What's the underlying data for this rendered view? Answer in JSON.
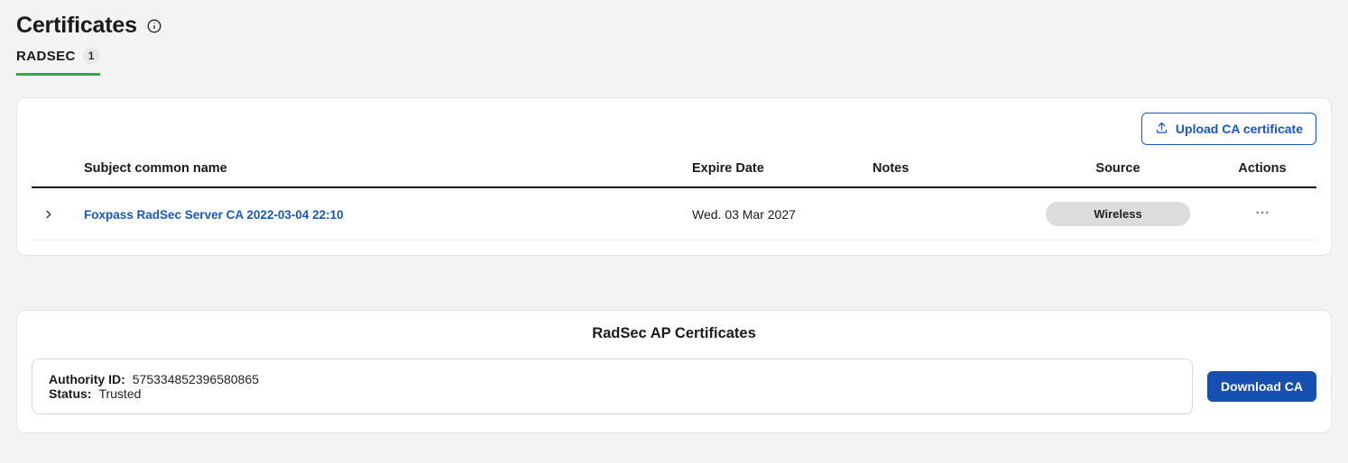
{
  "header": {
    "title": "Certificates"
  },
  "tabs": {
    "radsec": {
      "label": "RADSEC",
      "count": "1"
    }
  },
  "toolbar": {
    "upload_label": "Upload CA certificate"
  },
  "table": {
    "headers": {
      "subject": "Subject common name",
      "expire": "Expire Date",
      "notes": "Notes",
      "source": "Source",
      "actions": "Actions"
    },
    "rows": [
      {
        "subject": "Foxpass RadSec Server CA 2022-03-04 22:10",
        "expire": "Wed. 03 Mar 2027",
        "notes": "",
        "source": "Wireless"
      }
    ]
  },
  "ap_card": {
    "title": "RadSec AP Certificates",
    "authority_id_label": "Authority ID:",
    "authority_id_value": "575334852396580865",
    "status_label": "Status:",
    "status_value": "Trusted",
    "download_label": "Download CA"
  }
}
